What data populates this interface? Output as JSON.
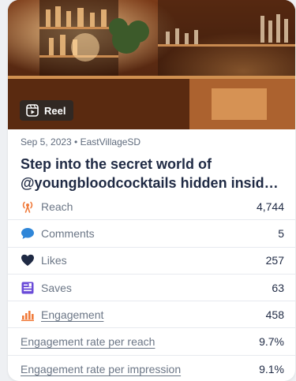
{
  "post": {
    "media_type_badge": "Reel",
    "date_account": "Sep 5, 2023 • EastVillageSD",
    "title_line1": "Step into the secret world of",
    "title_line2": "@youngbloodcocktails hidden insid…"
  },
  "metrics": [
    {
      "label": "Reach",
      "value": "4,744",
      "icon": "reach-icon",
      "color": "#f07a3a"
    },
    {
      "label": "Comments",
      "value": "5",
      "icon": "comment-icon",
      "color": "#2f86d8"
    },
    {
      "label": "Likes",
      "value": "257",
      "icon": "heart-icon",
      "color": "#1f2a44"
    },
    {
      "label": "Saves",
      "value": "63",
      "icon": "saves-icon",
      "color": "#6a4bd8"
    },
    {
      "label": "Engagement",
      "value": "458",
      "icon": "engagement-icon",
      "color": "#f07a3a"
    },
    {
      "label": "Engagement rate per reach",
      "value": "9.7%"
    },
    {
      "label": "Engagement rate per impression",
      "value": "9.1%"
    }
  ]
}
